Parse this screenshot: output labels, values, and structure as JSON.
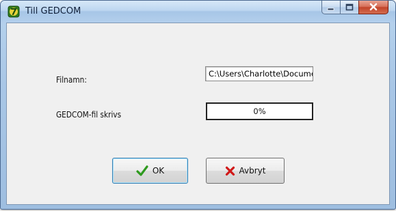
{
  "window": {
    "title": "Till GEDCOM",
    "caption_buttons": {
      "minimize_icon": "minimize-icon",
      "maximize_icon": "maximize-icon",
      "close_icon": "close-icon"
    },
    "app_icon": "family-tree-app-icon"
  },
  "form": {
    "filename_label": "Filnamn:",
    "filename_value": "C:\\Users\\Charlotte\\Documents",
    "progress_label": "GEDCOM-fil skrivs",
    "progress_text": "0%",
    "progress_fraction": 0
  },
  "buttons": {
    "ok_label": "OK",
    "ok_icon": "checkmark-icon",
    "cancel_label": "Avbryt",
    "cancel_icon": "red-x-icon"
  },
  "colors": {
    "titlebar": "#bcd6f0",
    "client_background": "#f0f0f0",
    "close_button": "#c2442a",
    "ok_check": "#2e9a1e",
    "cancel_x": "#d01818",
    "progress_fill": "#2a57c8"
  }
}
